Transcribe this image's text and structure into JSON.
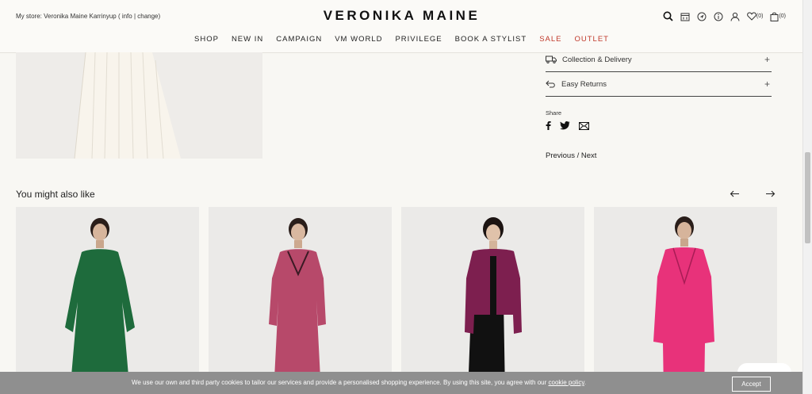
{
  "header": {
    "store_text": "My store: Veronika Maine Karrinyup ( info | change)",
    "brand": "VERONIKA MAINE",
    "wishlist_count": "(0)",
    "bag_count": "(0)",
    "icons": [
      "search-icon",
      "calendar-icon",
      "location-icon",
      "info-icon",
      "account-icon",
      "heart-icon",
      "bag-icon"
    ]
  },
  "nav": {
    "items": [
      {
        "label": "SHOP"
      },
      {
        "label": "NEW IN"
      },
      {
        "label": "CAMPAIGN"
      },
      {
        "label": "VM WORLD"
      },
      {
        "label": "PRIVILEGE"
      },
      {
        "label": "BOOK A STYLIST"
      },
      {
        "label": "SALE"
      },
      {
        "label": "OUTLET"
      }
    ],
    "sale_color": "#c0392b"
  },
  "accordion": {
    "collection": "Collection & Delivery",
    "returns": "Easy Returns"
  },
  "share": {
    "label": "Share",
    "icons": [
      "facebook-icon",
      "twitter-icon",
      "email-icon"
    ]
  },
  "pagination": {
    "previous": "Previous",
    "separator": "/",
    "next": "Next"
  },
  "recommendations": {
    "title": "You might also like",
    "products": [
      {
        "garment_color": "#1e6b3c"
      },
      {
        "garment_color": "#b7496a"
      },
      {
        "garment_color": "#7d1f4f"
      },
      {
        "garment_color": "#e8327a"
      }
    ]
  },
  "cookie": {
    "text": "We use our own and third party cookies to tailor our services and provide a personalised shopping experience. By using this site, you agree with our",
    "link": "cookie policy",
    "end": ".",
    "accept": "Accept"
  }
}
